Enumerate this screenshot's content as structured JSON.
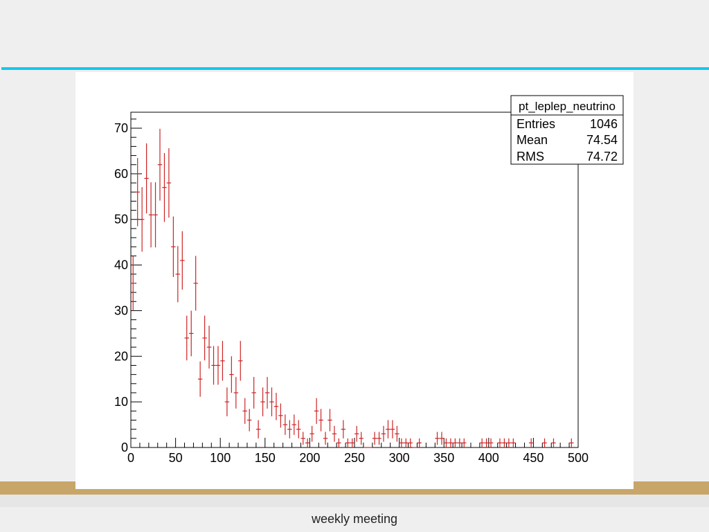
{
  "footer": {
    "text": "weekly meeting"
  },
  "colors": {
    "accent_rule": "#12c8ee",
    "band": "#c8a66a",
    "marker": "#cc2222"
  },
  "chart_data": {
    "type": "scatter",
    "title": "",
    "xlabel": "",
    "ylabel": "",
    "xlim": [
      0,
      500
    ],
    "ylim": [
      0,
      73.5
    ],
    "grid": false,
    "x_ticks": [
      0,
      50,
      100,
      150,
      200,
      250,
      300,
      350,
      400,
      450,
      500
    ],
    "y_ticks": [
      0,
      10,
      20,
      30,
      40,
      50,
      60,
      70
    ],
    "bin_width": 5,
    "stats_box": {
      "title": "pt_leplep_neutrino",
      "rows": [
        {
          "label": "Entries",
          "value": "1046"
        },
        {
          "label": "Mean",
          "value": "74.54"
        },
        {
          "label": "RMS",
          "value": "74.72"
        }
      ]
    },
    "series": [
      {
        "x": [
          2.5,
          7.5,
          12.5,
          17.5,
          22.5,
          27.5,
          32.5,
          37.5,
          42.5,
          47.5,
          52.5,
          57.5,
          62.5,
          67.5,
          72.5,
          77.5,
          82.5,
          87.5,
          92.5,
          97.5,
          102.5,
          107.5,
          112.5,
          117.5,
          122.5,
          127.5,
          132.5,
          137.5,
          142.5,
          147.5,
          152.5,
          157.5,
          162.5,
          167.5,
          172.5,
          177.5,
          182.5,
          187.5,
          192.5,
          197.5,
          202.5,
          207.5,
          212.5,
          217.5,
          222.5,
          227.5,
          232.5,
          237.5,
          242.5,
          247.5,
          252.5,
          257.5,
          262.5,
          267.5,
          272.5,
          277.5,
          282.5,
          287.5,
          292.5,
          297.5,
          302.5,
          307.5,
          312.5,
          317.5,
          322.5,
          342.5,
          347.5,
          352.5,
          357.5,
          362.5,
          367.5,
          372.5,
          392.5,
          397.5,
          402.5,
          412.5,
          417.5,
          422.5,
          427.5,
          447.5,
          462.5,
          472.5,
          492.5
        ],
        "y": [
          36,
          56,
          50,
          59,
          51,
          51,
          62,
          57,
          58,
          44,
          38,
          41,
          24,
          25,
          36,
          15,
          24,
          22,
          18,
          18,
          19,
          10,
          16,
          12,
          19,
          8,
          6,
          12,
          4,
          10,
          12,
          10,
          9,
          7,
          5,
          4,
          5,
          4,
          2,
          1,
          3,
          8,
          6,
          2,
          6,
          3,
          1,
          4,
          1,
          1,
          3,
          2,
          0,
          0,
          2,
          2,
          3,
          4,
          4,
          3,
          1,
          1,
          1,
          0,
          1,
          2,
          2,
          1,
          1,
          1,
          1,
          1,
          1,
          1,
          1,
          1,
          1,
          1,
          1,
          1,
          1,
          1,
          1
        ]
      }
    ]
  }
}
